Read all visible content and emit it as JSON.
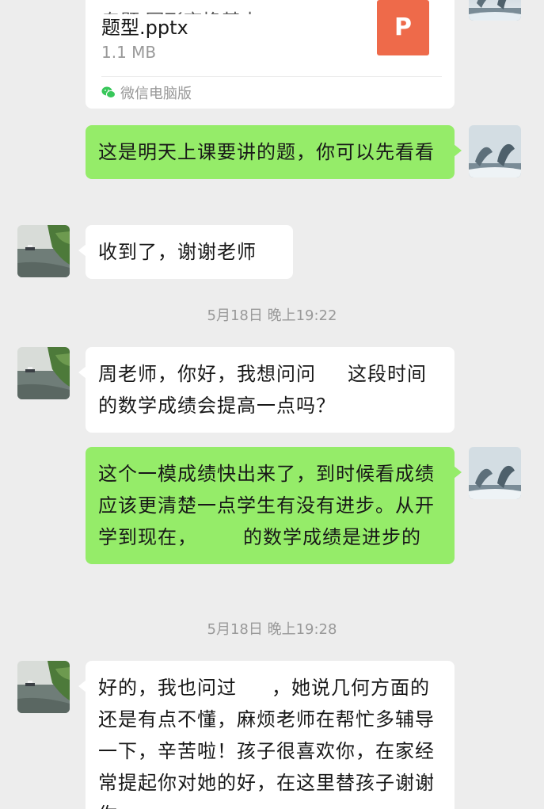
{
  "file_message": {
    "name_line1": "专题    图形变换基本",
    "name_line2": "题型.pptx",
    "size": "1.1 MB",
    "icon_letter": "P",
    "source": "微信电脑版"
  },
  "messages": [
    {
      "id": "m1",
      "direction": "out",
      "text": "这是明天上课要讲的题，你可以先看看"
    },
    {
      "id": "m2",
      "direction": "in",
      "text": "收到了，谢谢老师"
    },
    {
      "id": "m3",
      "direction": "in",
      "text_a": "周老师，你好，我想问问",
      "redacted": "  ",
      "text_b": "这段时间的数学成绩会提高一点吗？"
    },
    {
      "id": "m4",
      "direction": "out",
      "text_a": "这个一模成绩快出来了，到时候看成绩应该更清楚一点学生有没有进步。从开学到现在，",
      "redacted": "   ",
      "text_b": "的数学成绩是进步的"
    },
    {
      "id": "m5",
      "direction": "in",
      "text_a": "好的，我也问过",
      "redacted": "  ",
      "text_b": "，她说几何方面的还是有点不懂，麻烦老师在帮忙多辅导一下，辛苦啦！孩子很喜欢你，在家经常提起你对她的好，",
      "text_c": "在这里替孩子谢谢你"
    }
  ],
  "timestamps": {
    "t1": "5月18日 晚上19:22",
    "t2": "5月18日 晚上19:28"
  },
  "avatars": {
    "teacher": "dolphin-avatar",
    "parent": "lake-avatar"
  },
  "colors": {
    "background": "#ededed",
    "outgoing_bubble": "#95ec69",
    "incoming_bubble": "#ffffff",
    "ppt_icon": "#ee6a4a",
    "timestamp_text": "#999999"
  }
}
